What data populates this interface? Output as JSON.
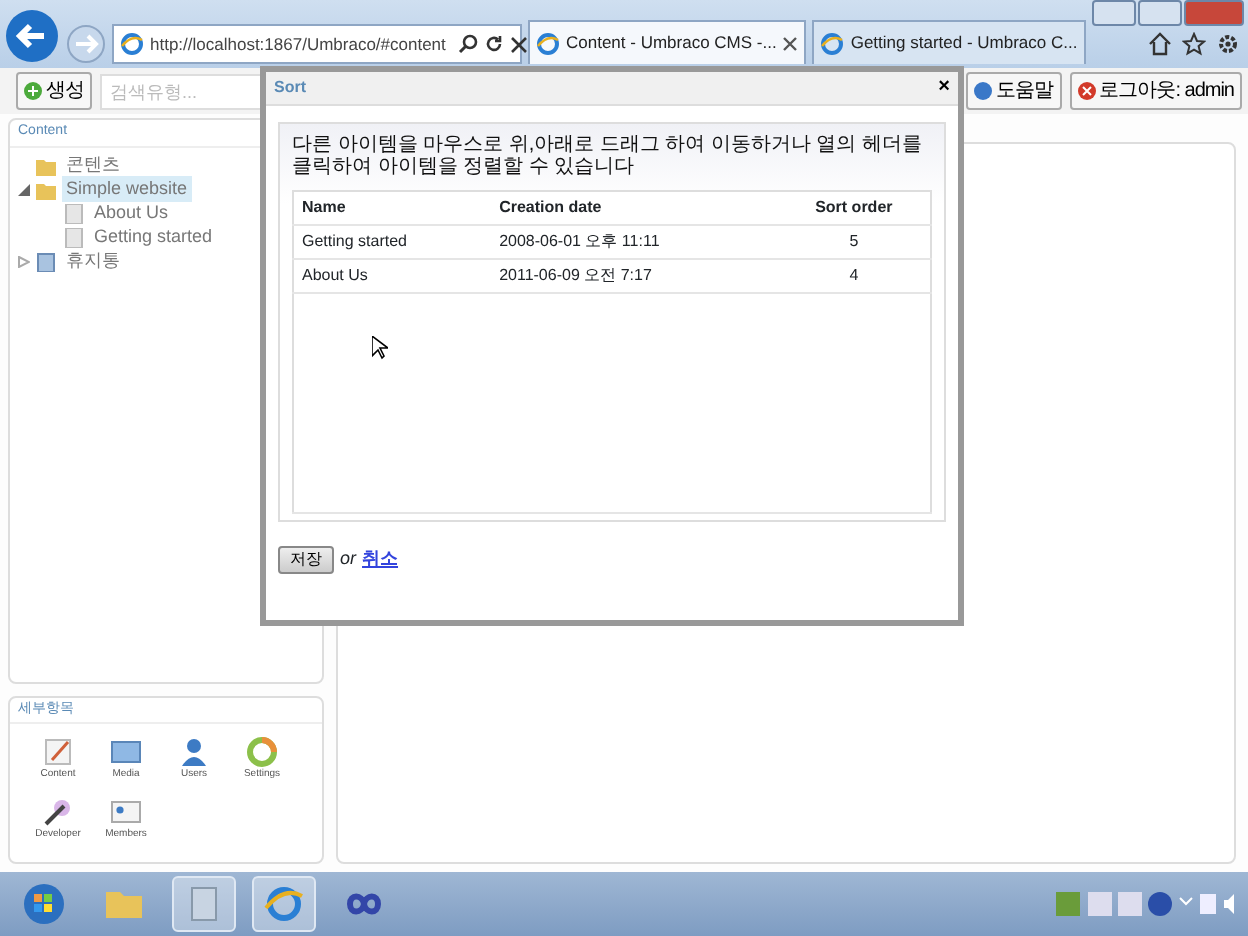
{
  "browser": {
    "address": "http://localhost:1867/Umbraco/#content",
    "tabs": [
      {
        "title": "Content - Umbraco CMS -...",
        "selected": true
      },
      {
        "title": "Getting started - Umbraco C...",
        "selected": false
      }
    ]
  },
  "toolbar": {
    "create_button": "생성",
    "search_placeholder": "검색유형...",
    "help_button": "도움말",
    "logout_button": "로그아웃: admin"
  },
  "tree": {
    "title": "Content",
    "items": [
      {
        "label": "콘텐츠",
        "kind": "folder",
        "selected": false
      },
      {
        "label": "Simple website",
        "kind": "folder",
        "selected": true,
        "expanded": true,
        "children": [
          {
            "label": "About Us",
            "kind": "page",
            "selected": false
          },
          {
            "label": "Getting started",
            "kind": "page",
            "selected": false
          }
        ]
      },
      {
        "label": "휴지통",
        "kind": "bin",
        "selected": false,
        "expanded": false
      }
    ]
  },
  "sections": {
    "title": "세부항목",
    "items": [
      {
        "label": "Content",
        "kind": "content"
      },
      {
        "label": "Media",
        "kind": "media"
      },
      {
        "label": "Users",
        "kind": "users"
      },
      {
        "label": "Settings",
        "kind": "settings"
      },
      {
        "label": "Developer",
        "kind": "developer"
      },
      {
        "label": "Members",
        "kind": "members"
      }
    ]
  },
  "dialog": {
    "title": "Sort",
    "close": "×",
    "instruction": "다른 아이템을 마우스로 위,아래로 드래그 하여 이동하거나 열의 헤더를 클릭하여 아이템을 정렬할 수 있습니다",
    "columns": [
      "Name",
      "Creation date",
      "Sort order"
    ],
    "rows": [
      {
        "name": "Getting started",
        "date": "2008-06-01 오후 11:11",
        "order": "5"
      },
      {
        "name": "About Us",
        "date": "2011-06-09 오전 7:17",
        "order": "4"
      }
    ],
    "save_button": "저장",
    "or_text": "or",
    "cancel_link": "취소"
  }
}
